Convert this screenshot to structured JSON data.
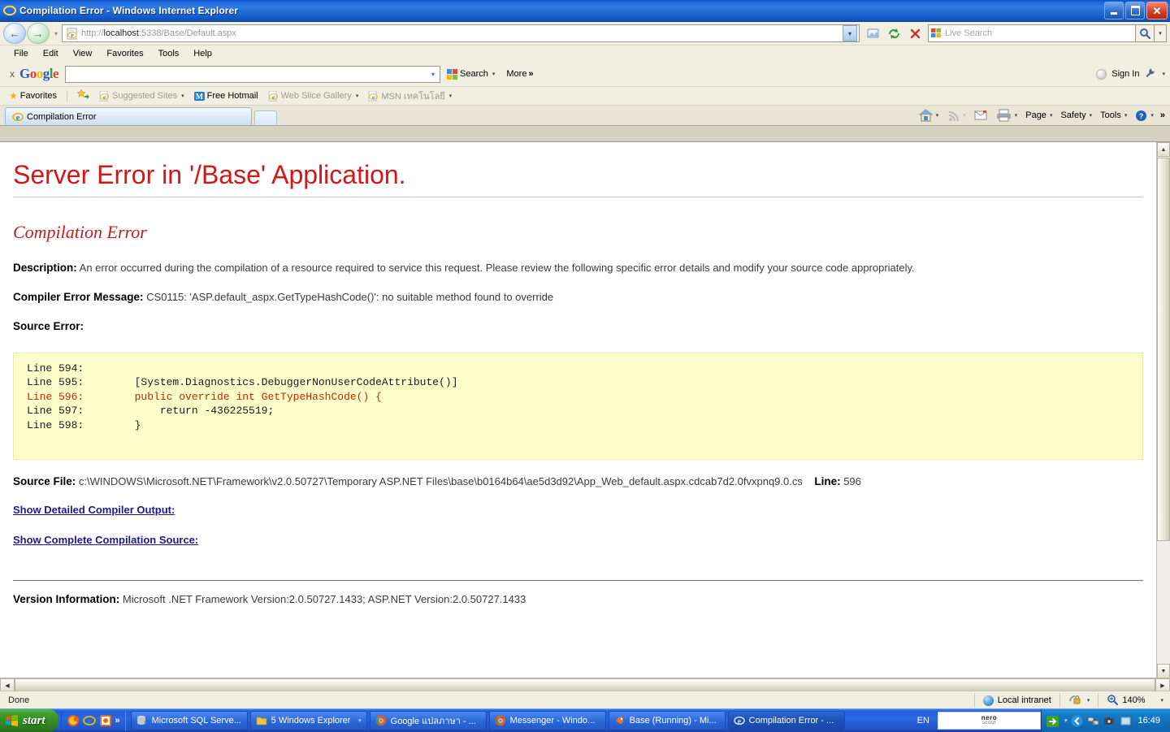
{
  "window": {
    "title": "Compilation Error - Windows Internet Explorer",
    "icon": "ie-icon",
    "minimize_label": "Minimize",
    "maximize_label": "Maximize",
    "close_label": "Close"
  },
  "address_bar": {
    "back_label": "Back",
    "forward_label": "Forward",
    "recent_pages_label": "Recent Pages",
    "url_prefix": "http://",
    "url_host": "localhost",
    "url_rest": ":5338/Base/Default.aspx",
    "url_full": "http://localhost:5338/Base/Default.aspx",
    "compat_label": "Compatibility View",
    "refresh_label": "Refresh",
    "stop_label": "Stop",
    "search_placeholder": "Live Search",
    "search_value": "",
    "search_button_label": "Search",
    "search_provider_label": "Search Options"
  },
  "menu": {
    "items": [
      "File",
      "Edit",
      "View",
      "Favorites",
      "Tools",
      "Help"
    ]
  },
  "google_toolbar": {
    "close_label": "x",
    "logo_letters": [
      {
        "c": "G",
        "k": "b"
      },
      {
        "c": "o",
        "k": "r"
      },
      {
        "c": "o",
        "k": "y"
      },
      {
        "c": "g",
        "k": "b"
      },
      {
        "c": "l",
        "k": "g"
      },
      {
        "c": "e",
        "k": "r"
      }
    ],
    "input_value": "",
    "search_label": "Search",
    "more_label": "More",
    "more_chevron": "»",
    "sign_in_label": "Sign In",
    "settings_label": "Settings"
  },
  "favorites_bar": {
    "favorites_label": "Favorites",
    "add_to_favorites_label": "Add to Favorites Bar",
    "items": [
      {
        "label": "Suggested Sites",
        "dim": true,
        "caret": true,
        "icon": "ie-icon"
      },
      {
        "label": "Free Hotmail",
        "dim": false,
        "caret": false,
        "icon": "hotmail-icon"
      },
      {
        "label": "Web Slice Gallery",
        "dim": true,
        "caret": true,
        "icon": "ie-icon"
      },
      {
        "label": "MSN เทคโนโลยี",
        "dim": true,
        "caret": true,
        "icon": "ie-icon"
      }
    ]
  },
  "tabs": {
    "items": [
      {
        "label": "Compilation Error",
        "icon": "ie-icon",
        "active": true
      }
    ],
    "new_tab_label": "New Tab"
  },
  "command_bar": {
    "home_label": "Home",
    "feeds_label": "Feeds",
    "mail_label": "Read Mail",
    "print_label": "Print",
    "items": [
      "Page",
      "Safety",
      "Tools"
    ],
    "help_label": "Help",
    "overflow": "»"
  },
  "page": {
    "heading": "Server Error in '/Base' Application.",
    "subheading": "Compilation Error",
    "description_label": "Description:",
    "description_text": "An error occurred during the compilation of a resource required to service this request. Please review the following specific error details and modify your source code appropriately.",
    "compiler_error_label": "Compiler Error Message:",
    "compiler_error_text": "CS0115: 'ASP.default_aspx.GetTypeHashCode()': no suitable method found to override",
    "source_error_label": "Source Error:",
    "code_lines": [
      {
        "text": "Line 594:",
        "code": "",
        "highlight": false
      },
      {
        "text": "Line 595:",
        "code": "        [System.Diagnostics.DebuggerNonUserCodeAttribute()]",
        "highlight": false
      },
      {
        "text": "Line 596:",
        "code": "        public override int GetTypeHashCode() {",
        "highlight": true
      },
      {
        "text": "Line 597:",
        "code": "            return -436225519;",
        "highlight": false
      },
      {
        "text": "Line 598:",
        "code": "        }",
        "highlight": false
      }
    ],
    "source_file_label": "Source File:",
    "source_file_path": "c:\\WINDOWS\\Microsoft.NET\\Framework\\v2.0.50727\\Temporary ASP.NET Files\\base\\b0164b64\\ae5d3d92\\App_Web_default.aspx.cdcab7d2.0fvxpnq9.0.cs",
    "line_label": "Line:",
    "line_value": "596",
    "links": [
      "Show Detailed Compiler Output:",
      "Show Complete Compilation Source:"
    ],
    "version_label": "Version Information:",
    "version_text": "Microsoft .NET Framework Version:2.0.50727.1433; ASP.NET Version:2.0.50727.1433",
    "colors": {
      "heading": "#d41616",
      "subheading": "#c22020",
      "code_background": "#ffffcc",
      "code_highlight": "#cc2200",
      "link": "#1a1a8c"
    }
  },
  "status_bar": {
    "status_text": "Done",
    "zone_label": "Local intranet",
    "zone_icon": "globe-icon",
    "protected_mode_icon": "lock-icon",
    "zoom_level": "140%",
    "zoom_icon": "zoom-icon"
  },
  "taskbar": {
    "start_label": "start",
    "quick_launch": [
      {
        "name": "firefox-icon"
      },
      {
        "name": "ie-icon"
      },
      {
        "name": "media-icon"
      }
    ],
    "quick_launch_overflow": "»",
    "tasks": [
      {
        "label": "Microsoft SQL Serve...",
        "icon": "sql-server-icon",
        "active": false,
        "caret": false
      },
      {
        "label": "5 Windows Explorer",
        "icon": "folder-icon",
        "active": false,
        "caret": true
      },
      {
        "label": "Google แปลภาษา - ...",
        "icon": "chrome-icon",
        "active": false,
        "caret": false
      },
      {
        "label": "Messenger - Windo...",
        "icon": "chrome-icon",
        "active": false,
        "caret": false
      },
      {
        "label": "Base (Running) - Mi...",
        "icon": "visual-studio-icon",
        "active": false,
        "caret": false
      },
      {
        "label": "Compilation Error - ...",
        "icon": "ie-icon",
        "active": true,
        "caret": false
      }
    ],
    "language_indicator": "EN",
    "nero_line1": "nero",
    "nero_line2": "scout",
    "tray_icons": [
      "show-desktop-icon",
      "volume-icon",
      "network-icon",
      "camera-icon",
      "screen-icon"
    ],
    "clock": "16:49"
  }
}
